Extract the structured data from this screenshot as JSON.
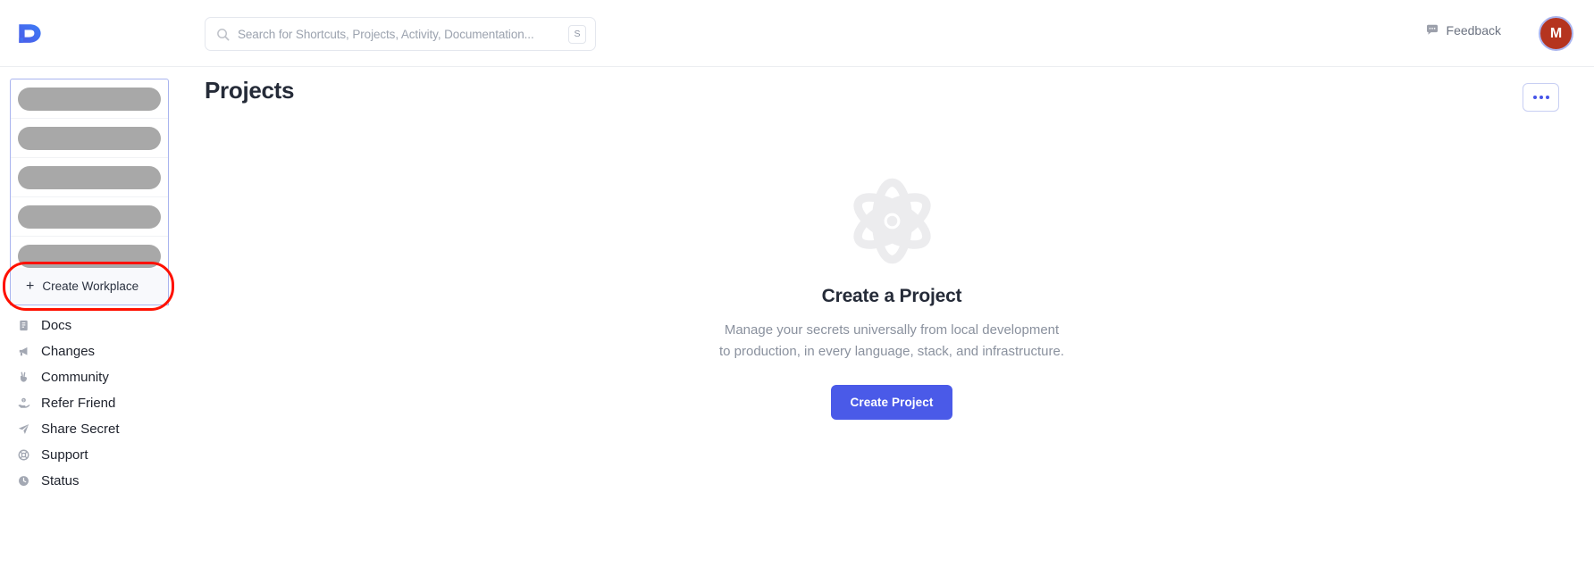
{
  "topbar": {
    "logo": "logo-mark",
    "search": {
      "placeholder": "Search for Shortcuts, Projects, Activity, Documentation...",
      "value": "",
      "shortcut_key": "S"
    },
    "feedback_label": "Feedback",
    "avatar_initial": "M"
  },
  "sidebar": {
    "workspace_skeletons": [
      {
        "id": "skeleton-1"
      },
      {
        "id": "skeleton-2"
      },
      {
        "id": "skeleton-3"
      },
      {
        "id": "skeleton-4"
      },
      {
        "id": "skeleton-5"
      }
    ],
    "create_workplace_label": "Create Workplace",
    "nav_items": [
      {
        "label": "Docs",
        "icon": "book-icon"
      },
      {
        "label": "Changes",
        "icon": "megaphone-icon"
      },
      {
        "label": "Community",
        "icon": "peace-hand-icon"
      },
      {
        "label": "Refer Friend",
        "icon": "hand-coin-icon"
      },
      {
        "label": "Share Secret",
        "icon": "paper-plane-icon"
      },
      {
        "label": "Support",
        "icon": "lifebuoy-icon"
      },
      {
        "label": "Status",
        "icon": "clock-icon"
      }
    ]
  },
  "main": {
    "page_title": "Projects",
    "more_menu_label": "...",
    "empty_state": {
      "illustration": "atom-icon",
      "title": "Create a Project",
      "description_line1": "Manage your secrets universally from local development",
      "description_line2": "to production, in every language, stack, and infrastructure.",
      "cta_label": "Create Project"
    }
  },
  "colors": {
    "accent": "#4a5ae8",
    "highlight_ring": "#ff1100",
    "avatar_bg": "#b5341f",
    "skeleton": "#a8a8a8",
    "panel_border": "#a9b4ef"
  }
}
